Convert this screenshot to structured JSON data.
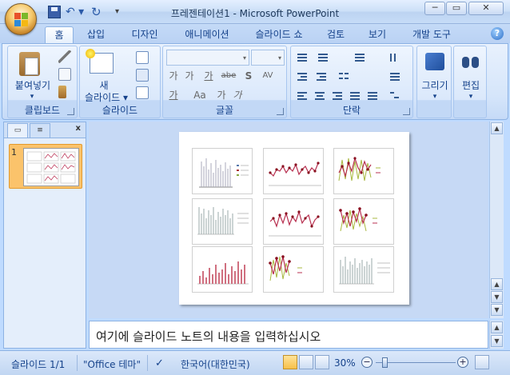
{
  "window": {
    "title": "프레젠테이션1 - Microsoft PowerPoint",
    "controls": {
      "minimize": "─",
      "maximize": "▭",
      "close": "✕"
    }
  },
  "quick_access": {
    "undo": "↶ ▾",
    "redo": "↻",
    "more": "▾"
  },
  "tabs": [
    {
      "label": "홈",
      "active": true
    },
    {
      "label": "삽입"
    },
    {
      "label": "디자인"
    },
    {
      "label": "애니메이션"
    },
    {
      "label": "슬라이드 쇼"
    },
    {
      "label": "검토"
    },
    {
      "label": "보기"
    },
    {
      "label": "개발 도구"
    }
  ],
  "help": "?",
  "ribbon": {
    "clipboard": {
      "label": "클립보드",
      "paste": "붙여넣기",
      "paste_arrow": "▾"
    },
    "slides": {
      "label": "슬라이드",
      "new_slide_1": "새",
      "new_slide_2": "슬라이드 ▾"
    },
    "font": {
      "label": "글꼴",
      "bold": "가",
      "italic": "가",
      "underline": "가",
      "strike": "abe",
      "shadow": "S",
      "spacing": "AV",
      "case": "Aa",
      "grow": "가",
      "shrink": "가",
      "color": "가"
    },
    "paragraph": {
      "label": "단락"
    },
    "drawing": {
      "label": "그리기",
      "arrow": "▾"
    },
    "editing": {
      "label": "편집",
      "arrow": "▾"
    }
  },
  "left_pane": {
    "slide_number": "1",
    "close": "x"
  },
  "notes": {
    "placeholder": "여기에 슬라이드 노트의 내용을 입력하십시오"
  },
  "status": {
    "slide": "슬라이드 1/1",
    "theme": "\"Office 테마\"",
    "language": "한국어(대한민국)",
    "zoom": "30%",
    "zoom_level": 0.3
  },
  "colors": {
    "accent": "#15428b",
    "ribbon_bg": "#bfdbff",
    "selected_thumb": "#fbc36b"
  }
}
